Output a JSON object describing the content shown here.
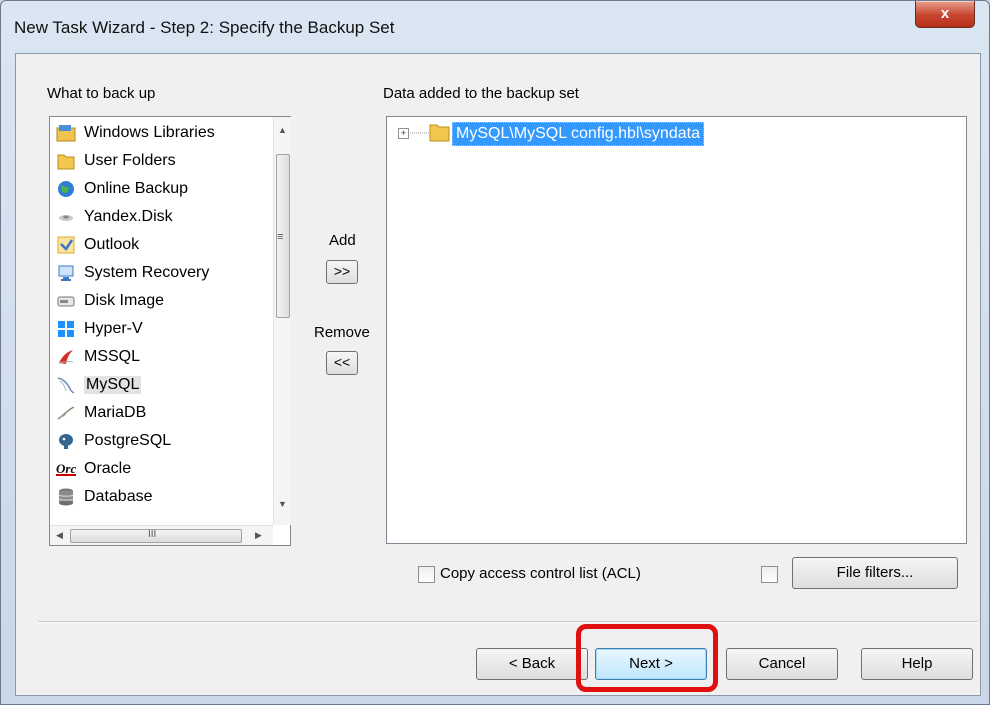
{
  "window": {
    "title": "New Task Wizard - Step 2: Specify the Backup Set",
    "close_label": "x"
  },
  "left_panel": {
    "label": "What to back up",
    "items": [
      {
        "label": "Windows Libraries",
        "icon": "windows-libraries-icon"
      },
      {
        "label": "User Folders",
        "icon": "folder-icon"
      },
      {
        "label": "Online Backup",
        "icon": "globe-icon"
      },
      {
        "label": "Yandex.Disk",
        "icon": "yandex-disk-icon"
      },
      {
        "label": "Outlook",
        "icon": "outlook-icon"
      },
      {
        "label": "System Recovery",
        "icon": "system-recovery-icon"
      },
      {
        "label": "Disk Image",
        "icon": "disk-image-icon"
      },
      {
        "label": "Hyper-V",
        "icon": "hyper-v-icon"
      },
      {
        "label": "MSSQL",
        "icon": "mssql-icon"
      },
      {
        "label": "MySQL",
        "icon": "mysql-icon",
        "selected": true
      },
      {
        "label": "MariaDB",
        "icon": "mariadb-icon"
      },
      {
        "label": "PostgreSQL",
        "icon": "postgresql-icon"
      },
      {
        "label": "Oracle",
        "icon": "oracle-icon"
      },
      {
        "label": "Database",
        "icon": "database-icon"
      }
    ],
    "hscroll_grip": "III"
  },
  "middle": {
    "add_label": "Add",
    "add_button": ">>",
    "remove_label": "Remove",
    "remove_button": "<<"
  },
  "right_panel": {
    "label": "Data added to the backup set",
    "tree_item": "MySQL\\MySQL config.hbl\\syndata",
    "expander": "+"
  },
  "options": {
    "acl_label": "Copy access control list (ACL)",
    "acl_checked": false,
    "filters_checked": false,
    "filters_button": "File filters..."
  },
  "footer": {
    "back": "< Back",
    "next": "Next >",
    "cancel": "Cancel",
    "help": "Help"
  },
  "colors": {
    "selection": "#3399ff",
    "highlight_border": "#e01010",
    "close_button": "#c7452e"
  }
}
